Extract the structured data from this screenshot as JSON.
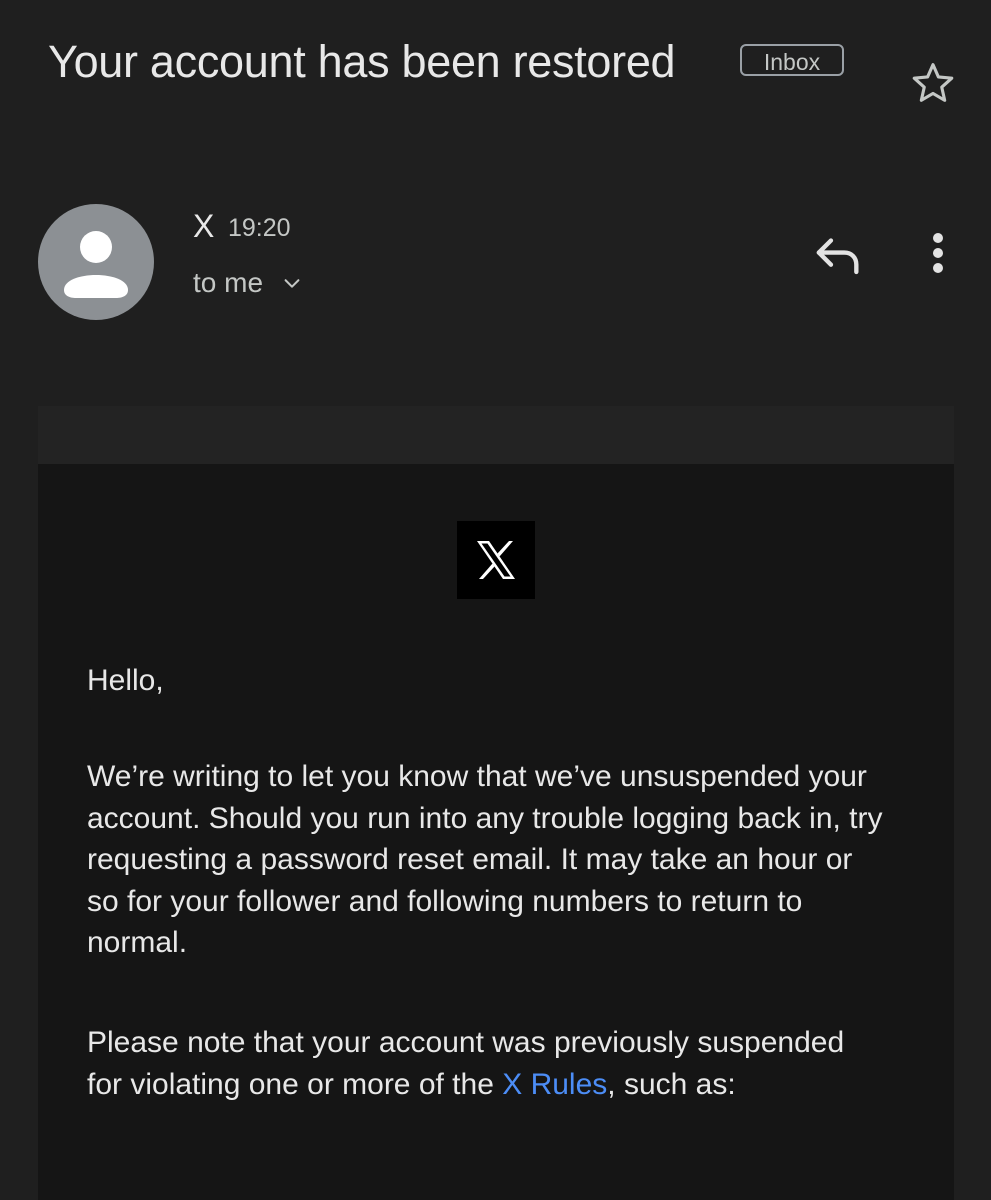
{
  "header": {
    "subject": "Your account has been restored",
    "label": "Inbox"
  },
  "sender": {
    "name": "X",
    "time": "19:20",
    "recipient_label": "to me"
  },
  "icons": {
    "star": "star-icon",
    "reply": "reply-icon",
    "more": "more-vert-icon",
    "expand": "chevron-down-icon",
    "avatar": "person-icon",
    "brand": "x-logo-icon"
  },
  "email": {
    "greeting": "Hello,",
    "paragraph1": "We’re writing to let you know that we’ve unsuspended your account. Should you run into any trouble logging back in, try requesting a password reset email. It may take an hour or so for your follower and following numbers to return to normal.",
    "paragraph2_before": "Please note that your account was previously suspended for violating one or more of the ",
    "paragraph2_link": "X Rules",
    "paragraph2_after": ", such as:"
  },
  "colors": {
    "background": "#1f1f1f",
    "email_body": "#151515",
    "link": "#4c8df6",
    "avatar": "#8c9094"
  }
}
